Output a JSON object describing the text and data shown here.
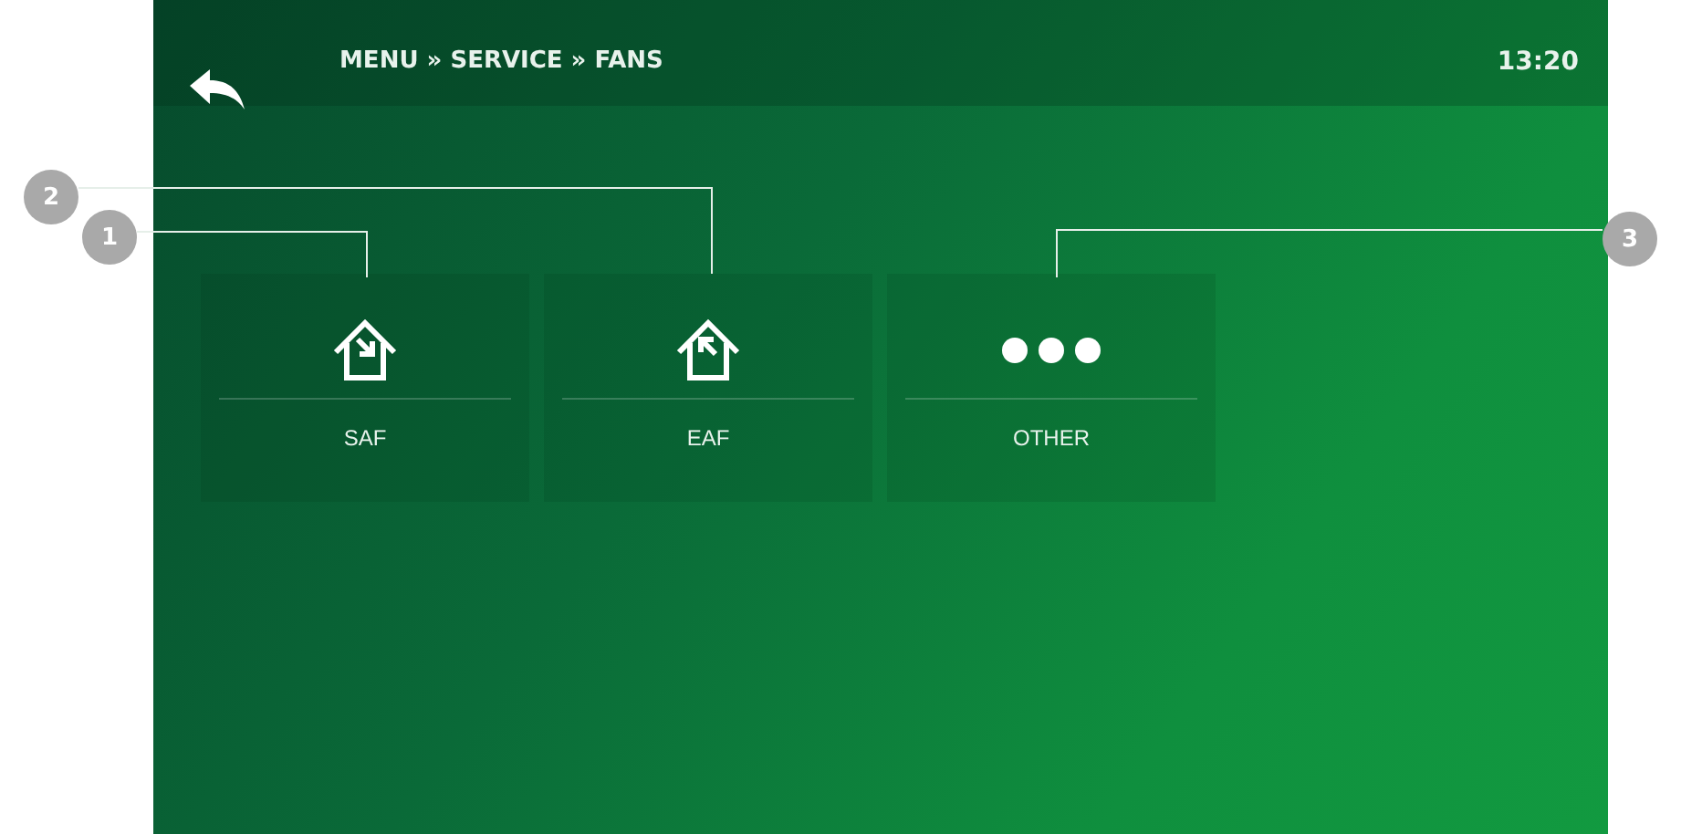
{
  "header": {
    "breadcrumb": "MENU » SERVICE » FANS",
    "time": "13:20"
  },
  "tiles": [
    {
      "kind": "supply",
      "label": "SAF"
    },
    {
      "kind": "extract",
      "label": "EAF"
    },
    {
      "kind": "more",
      "label": "OTHER"
    }
  ],
  "callouts": [
    {
      "number": "1"
    },
    {
      "number": "2"
    },
    {
      "number": "3"
    }
  ]
}
